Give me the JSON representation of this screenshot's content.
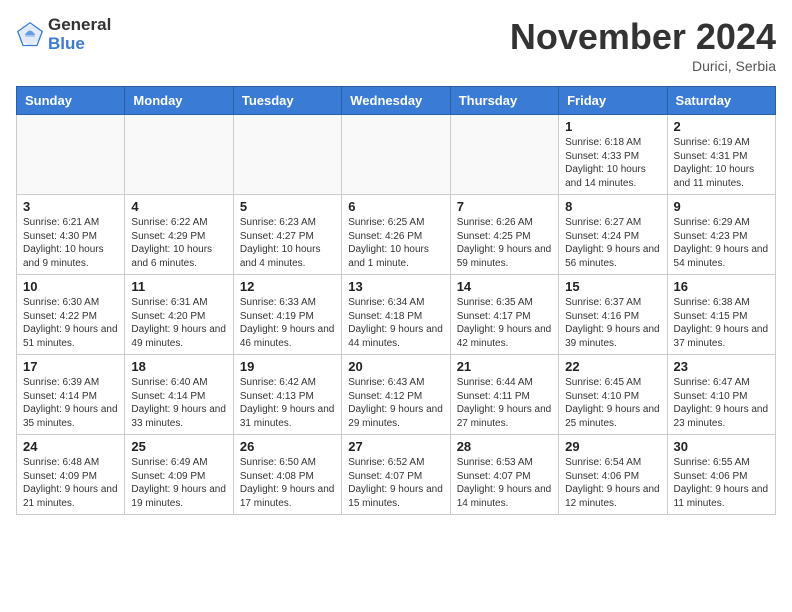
{
  "logo": {
    "general": "General",
    "blue": "Blue"
  },
  "title": "November 2024",
  "location": "Durici, Serbia",
  "days_of_week": [
    "Sunday",
    "Monday",
    "Tuesday",
    "Wednesday",
    "Thursday",
    "Friday",
    "Saturday"
  ],
  "weeks": [
    [
      {
        "day": "",
        "info": ""
      },
      {
        "day": "",
        "info": ""
      },
      {
        "day": "",
        "info": ""
      },
      {
        "day": "",
        "info": ""
      },
      {
        "day": "",
        "info": ""
      },
      {
        "day": "1",
        "info": "Sunrise: 6:18 AM\nSunset: 4:33 PM\nDaylight: 10 hours and 14 minutes."
      },
      {
        "day": "2",
        "info": "Sunrise: 6:19 AM\nSunset: 4:31 PM\nDaylight: 10 hours and 11 minutes."
      }
    ],
    [
      {
        "day": "3",
        "info": "Sunrise: 6:21 AM\nSunset: 4:30 PM\nDaylight: 10 hours and 9 minutes."
      },
      {
        "day": "4",
        "info": "Sunrise: 6:22 AM\nSunset: 4:29 PM\nDaylight: 10 hours and 6 minutes."
      },
      {
        "day": "5",
        "info": "Sunrise: 6:23 AM\nSunset: 4:27 PM\nDaylight: 10 hours and 4 minutes."
      },
      {
        "day": "6",
        "info": "Sunrise: 6:25 AM\nSunset: 4:26 PM\nDaylight: 10 hours and 1 minute."
      },
      {
        "day": "7",
        "info": "Sunrise: 6:26 AM\nSunset: 4:25 PM\nDaylight: 9 hours and 59 minutes."
      },
      {
        "day": "8",
        "info": "Sunrise: 6:27 AM\nSunset: 4:24 PM\nDaylight: 9 hours and 56 minutes."
      },
      {
        "day": "9",
        "info": "Sunrise: 6:29 AM\nSunset: 4:23 PM\nDaylight: 9 hours and 54 minutes."
      }
    ],
    [
      {
        "day": "10",
        "info": "Sunrise: 6:30 AM\nSunset: 4:22 PM\nDaylight: 9 hours and 51 minutes."
      },
      {
        "day": "11",
        "info": "Sunrise: 6:31 AM\nSunset: 4:20 PM\nDaylight: 9 hours and 49 minutes."
      },
      {
        "day": "12",
        "info": "Sunrise: 6:33 AM\nSunset: 4:19 PM\nDaylight: 9 hours and 46 minutes."
      },
      {
        "day": "13",
        "info": "Sunrise: 6:34 AM\nSunset: 4:18 PM\nDaylight: 9 hours and 44 minutes."
      },
      {
        "day": "14",
        "info": "Sunrise: 6:35 AM\nSunset: 4:17 PM\nDaylight: 9 hours and 42 minutes."
      },
      {
        "day": "15",
        "info": "Sunrise: 6:37 AM\nSunset: 4:16 PM\nDaylight: 9 hours and 39 minutes."
      },
      {
        "day": "16",
        "info": "Sunrise: 6:38 AM\nSunset: 4:15 PM\nDaylight: 9 hours and 37 minutes."
      }
    ],
    [
      {
        "day": "17",
        "info": "Sunrise: 6:39 AM\nSunset: 4:14 PM\nDaylight: 9 hours and 35 minutes."
      },
      {
        "day": "18",
        "info": "Sunrise: 6:40 AM\nSunset: 4:14 PM\nDaylight: 9 hours and 33 minutes."
      },
      {
        "day": "19",
        "info": "Sunrise: 6:42 AM\nSunset: 4:13 PM\nDaylight: 9 hours and 31 minutes."
      },
      {
        "day": "20",
        "info": "Sunrise: 6:43 AM\nSunset: 4:12 PM\nDaylight: 9 hours and 29 minutes."
      },
      {
        "day": "21",
        "info": "Sunrise: 6:44 AM\nSunset: 4:11 PM\nDaylight: 9 hours and 27 minutes."
      },
      {
        "day": "22",
        "info": "Sunrise: 6:45 AM\nSunset: 4:10 PM\nDaylight: 9 hours and 25 minutes."
      },
      {
        "day": "23",
        "info": "Sunrise: 6:47 AM\nSunset: 4:10 PM\nDaylight: 9 hours and 23 minutes."
      }
    ],
    [
      {
        "day": "24",
        "info": "Sunrise: 6:48 AM\nSunset: 4:09 PM\nDaylight: 9 hours and 21 minutes."
      },
      {
        "day": "25",
        "info": "Sunrise: 6:49 AM\nSunset: 4:09 PM\nDaylight: 9 hours and 19 minutes."
      },
      {
        "day": "26",
        "info": "Sunrise: 6:50 AM\nSunset: 4:08 PM\nDaylight: 9 hours and 17 minutes."
      },
      {
        "day": "27",
        "info": "Sunrise: 6:52 AM\nSunset: 4:07 PM\nDaylight: 9 hours and 15 minutes."
      },
      {
        "day": "28",
        "info": "Sunrise: 6:53 AM\nSunset: 4:07 PM\nDaylight: 9 hours and 14 minutes."
      },
      {
        "day": "29",
        "info": "Sunrise: 6:54 AM\nSunset: 4:06 PM\nDaylight: 9 hours and 12 minutes."
      },
      {
        "day": "30",
        "info": "Sunrise: 6:55 AM\nSunset: 4:06 PM\nDaylight: 9 hours and 11 minutes."
      }
    ]
  ]
}
